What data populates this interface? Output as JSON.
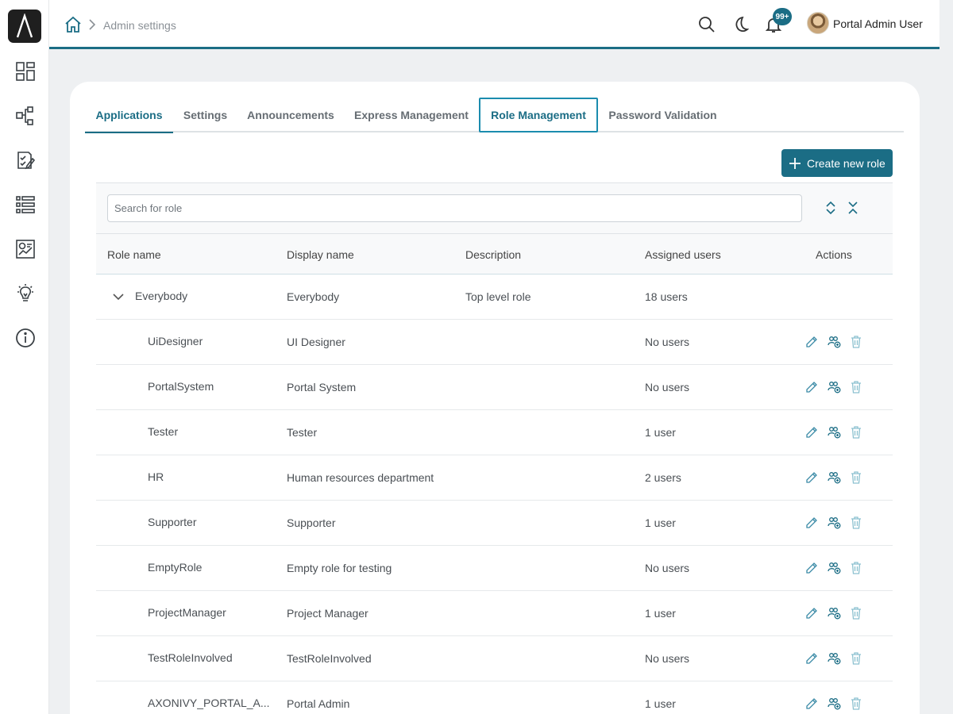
{
  "header": {
    "breadcrumb_current": "Admin settings",
    "notification_badge": "99+",
    "user_name": "Portal Admin User"
  },
  "sidebar": {
    "items": [
      {
        "icon": "dashboard-icon"
      },
      {
        "icon": "process-icon"
      },
      {
        "icon": "task-icon"
      },
      {
        "icon": "list-icon"
      },
      {
        "icon": "statistics-icon"
      },
      {
        "icon": "idea-icon"
      },
      {
        "icon": "info-icon"
      }
    ]
  },
  "tabs": [
    {
      "label": "Applications"
    },
    {
      "label": "Settings"
    },
    {
      "label": "Announcements"
    },
    {
      "label": "Express Management"
    },
    {
      "label": "Role Management"
    },
    {
      "label": "Password Validation"
    }
  ],
  "create_button_label": "Create new role",
  "search": {
    "placeholder": "Search for role"
  },
  "table": {
    "headers": {
      "role_name": "Role name",
      "display_name": "Display name",
      "description": "Description",
      "assigned_users": "Assigned users",
      "actions": "Actions"
    },
    "rows": [
      {
        "role": "Everybody",
        "display": "Everybody",
        "description": "Top level role",
        "users": "18 users"
      },
      {
        "role": "UiDesigner",
        "display": "UI Designer",
        "description": "",
        "users": "No users"
      },
      {
        "role": "PortalSystem",
        "display": "Portal System",
        "description": "",
        "users": "No users"
      },
      {
        "role": "Tester",
        "display": "Tester",
        "description": "",
        "users": "1 user"
      },
      {
        "role": "HR",
        "display": "Human resources department",
        "description": "",
        "users": "2 users"
      },
      {
        "role": "Supporter",
        "display": "Supporter",
        "description": "",
        "users": "1 user"
      },
      {
        "role": "EmptyRole",
        "display": "Empty role for testing",
        "description": "",
        "users": "No users"
      },
      {
        "role": "ProjectManager",
        "display": "Project Manager",
        "description": "",
        "users": "1 user"
      },
      {
        "role": "TestRoleInvolved",
        "display": "TestRoleInvolved",
        "description": "",
        "users": "No users"
      },
      {
        "role": "AXONIVY_PORTAL_A...",
        "display": "Portal Admin",
        "description": "",
        "users": "1 user"
      }
    ]
  },
  "colors": {
    "accent": "#1b6d85",
    "focus_ring": "#1b8cae",
    "background": "#eef0f2"
  }
}
